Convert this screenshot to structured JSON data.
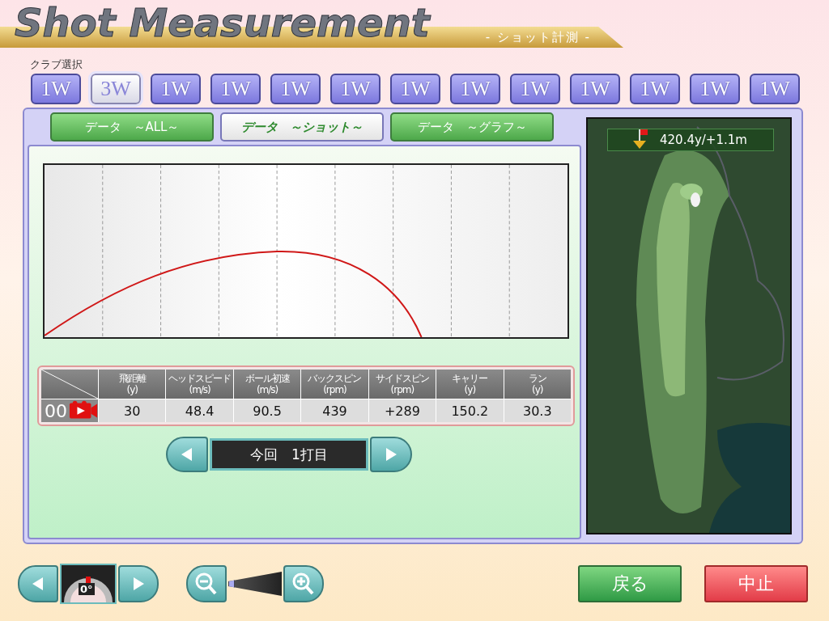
{
  "header": {
    "title": "Shot Measurement",
    "subtitle": "- ショット計測 -"
  },
  "club_select": {
    "label": "クラブ選択",
    "clubs": [
      {
        "label": "1W",
        "selected": false
      },
      {
        "label": "3W",
        "selected": true
      },
      {
        "label": "1W",
        "selected": false
      },
      {
        "label": "1W",
        "selected": false
      },
      {
        "label": "1W",
        "selected": false
      },
      {
        "label": "1W",
        "selected": false
      },
      {
        "label": "1W",
        "selected": false
      },
      {
        "label": "1W",
        "selected": false
      },
      {
        "label": "1W",
        "selected": false
      },
      {
        "label": "1W",
        "selected": false
      },
      {
        "label": "1W",
        "selected": false
      },
      {
        "label": "1W",
        "selected": false
      },
      {
        "label": "1W",
        "selected": false
      }
    ]
  },
  "tabs": [
    {
      "label": "データ　～ALL～",
      "selected": false
    },
    {
      "label": "データ　～ショット～",
      "selected": true
    },
    {
      "label": "データ　～グラフ～",
      "selected": false
    }
  ],
  "table": {
    "columns": [
      {
        "label": "飛距離",
        "unit": "(y)"
      },
      {
        "label": "ヘッドスピード",
        "unit": "(m/s)"
      },
      {
        "label": "ボール初速",
        "unit": "(m/s)"
      },
      {
        "label": "バックスピン",
        "unit": "(rpm)"
      },
      {
        "label": "サイドスピン",
        "unit": "(rpm)"
      },
      {
        "label": "キャリー",
        "unit": "(y)"
      },
      {
        "label": "ラン",
        "unit": "(y)"
      }
    ],
    "rows": [
      {
        "number": "00",
        "cells": [
          "30",
          "48.4",
          "90.5",
          "439",
          "+289",
          "150.2",
          "30.3"
        ]
      }
    ]
  },
  "shot_nav": {
    "label": "今回　1打目"
  },
  "map": {
    "distance": "420.4y/+1.1m"
  },
  "angle": {
    "reading": "0°"
  },
  "zoom": {
    "level": 0
  },
  "buttons": [
    {
      "label": "戻る",
      "kind": "back"
    },
    {
      "label": "中止",
      "kind": "stop"
    }
  ]
}
